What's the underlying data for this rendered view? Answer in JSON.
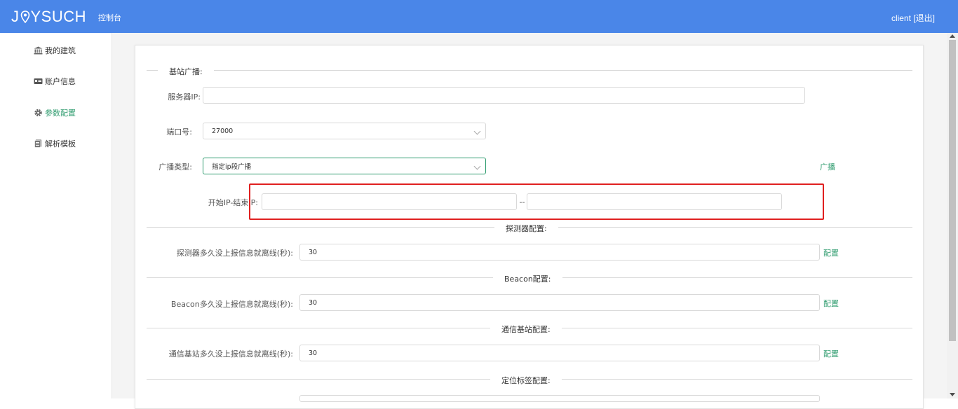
{
  "header": {
    "logo_left": "J",
    "logo_right": "YSUCH",
    "console": "控制台",
    "user": "client",
    "logout": "[退出]"
  },
  "sidebar": {
    "items": [
      {
        "label": "我的建筑",
        "icon": "building-icon",
        "active": false
      },
      {
        "label": "账户信息",
        "icon": "id-card-icon",
        "active": false
      },
      {
        "label": "参数配置",
        "icon": "gear-icon",
        "active": true
      },
      {
        "label": "解析模板",
        "icon": "document-icon",
        "active": false
      }
    ]
  },
  "base_station_broadcast": {
    "title": "基站广播:",
    "server_ip_label": "服务器IP:",
    "server_ip_value": "",
    "port_label": "端口号:",
    "port_value": "27000",
    "type_label": "广播类型:",
    "type_value": "指定ip段广播",
    "broadcast_link": "广播",
    "range_label": "开始IP-结束IP:",
    "range_separator": "--",
    "start_ip": "",
    "end_ip": ""
  },
  "detector": {
    "title": "探测器配置:",
    "label": "探测器多久没上报信息就离线(秒):",
    "value": "30",
    "link": "配置"
  },
  "beacon": {
    "title": "Beacon配置:",
    "label": "Beacon多久没上报信息就离线(秒):",
    "value": "30",
    "link": "配置"
  },
  "comm_station": {
    "title": "通信基站配置:",
    "label": "通信基站多久没上报信息就离线(秒):",
    "value": "30",
    "link": "配置"
  },
  "locator_tag": {
    "title": "定位标签配置:"
  },
  "colors": {
    "header_bg": "#4a86e8",
    "accent": "#2e9b6e",
    "highlight_box": "#e02020"
  }
}
